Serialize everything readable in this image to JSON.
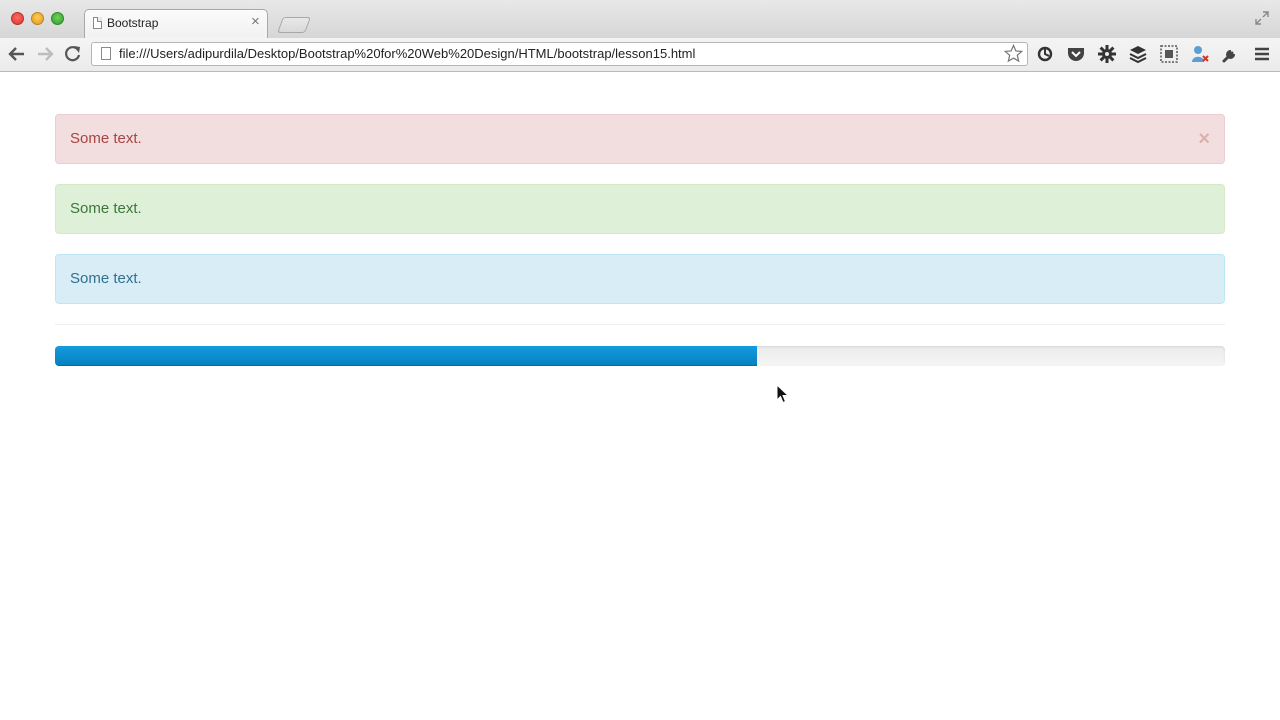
{
  "browser": {
    "tab": {
      "title": "Bootstrap",
      "close_glyph": "×"
    },
    "address_bar": {
      "url": "file:///Users/adipurdila/Desktop/Bootstrap%20for%20Web%20Design/HTML/bootstrap/lesson15.html"
    },
    "toolbar_icons": [
      "back-icon",
      "forward-icon",
      "reload-icon",
      "bookmark-star-icon",
      "extension-icons",
      "wrench-icon",
      "menu-icon"
    ]
  },
  "page": {
    "alerts": [
      {
        "type": "danger",
        "text": "Some text.",
        "dismiss_glyph": "×",
        "color": "#a94442",
        "background": "#f2dede"
      },
      {
        "type": "success",
        "text": "Some text.",
        "color": "#3c763d",
        "background": "#dff0d8"
      },
      {
        "type": "info",
        "text": "Some text.",
        "color": "#31708f",
        "background": "#d9edf7"
      }
    ],
    "progress": {
      "value_percent": 60,
      "bar_color": "#0e90d2"
    }
  }
}
